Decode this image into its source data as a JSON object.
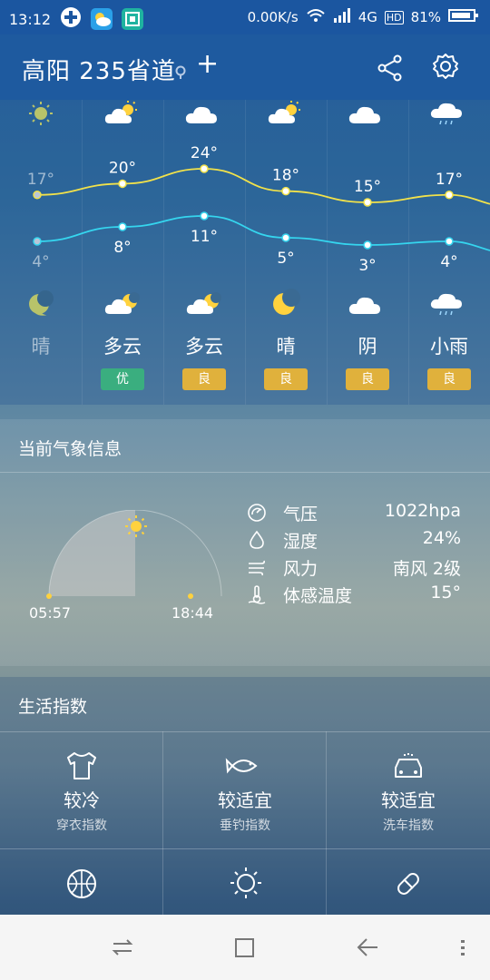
{
  "status": {
    "time": "13:12",
    "speed": "0.00K/s",
    "network": "4G",
    "hd": "HD",
    "battery": "81%"
  },
  "header": {
    "location": "高阳 235省道",
    "add_label": "+"
  },
  "forecast": {
    "days": [
      {
        "cond": "晴",
        "high": "17°",
        "low": "4°",
        "aqi": "",
        "day_icon": "sun-icon",
        "night_icon": "moon-icon"
      },
      {
        "cond": "多云",
        "high": "20°",
        "low": "8°",
        "aqi": "优",
        "day_icon": "cloud-sun-icon",
        "night_icon": "cloud-moon-icon"
      },
      {
        "cond": "多云",
        "high": "24°",
        "low": "11°",
        "aqi": "良",
        "day_icon": "cloud-icon",
        "night_icon": "cloud-moon-icon"
      },
      {
        "cond": "晴",
        "high": "18°",
        "low": "5°",
        "aqi": "良",
        "day_icon": "cloud-sun-icon",
        "night_icon": "moon-icon"
      },
      {
        "cond": "阴",
        "high": "15°",
        "low": "3°",
        "aqi": "良",
        "day_icon": "cloud-icon",
        "night_icon": "cloud-icon"
      },
      {
        "cond": "小雨",
        "high": "17°",
        "low": "4°",
        "aqi": "良",
        "day_icon": "rain-icon",
        "night_icon": "rain-icon"
      }
    ],
    "highs": [
      17,
      20,
      24,
      18,
      15,
      17
    ],
    "lows": [
      4,
      8,
      11,
      5,
      3,
      4
    ],
    "colors": {
      "high_line": "#f2e24a",
      "low_line": "#35d6ef",
      "aqi_good": "#3aae7f",
      "aqi_ok": "#e0b13c"
    }
  },
  "current": {
    "title": "当前气象信息",
    "sunrise": "05:57",
    "sunset": "18:44",
    "daylight_fraction": 0.5,
    "rows": [
      {
        "label": "气压",
        "value": "1022hpa",
        "icon": "gauge-icon"
      },
      {
        "label": "湿度",
        "value": "24%",
        "icon": "droplet-icon"
      },
      {
        "label": "风力",
        "value": "南风 2级",
        "icon": "wind-icon"
      },
      {
        "label": "体感温度",
        "value": "15°",
        "icon": "thermometer-icon"
      }
    ]
  },
  "life": {
    "title": "生活指数",
    "items": [
      {
        "value": "较冷",
        "name": "穿衣指数",
        "icon": "tshirt-icon"
      },
      {
        "value": "较适宜",
        "name": "垂钓指数",
        "icon": "fish-icon"
      },
      {
        "value": "较适宜",
        "name": "洗车指数",
        "icon": "car-icon"
      }
    ],
    "row2_icons": [
      "ball-icon",
      "sun-outline-icon",
      "pill-icon"
    ]
  }
}
